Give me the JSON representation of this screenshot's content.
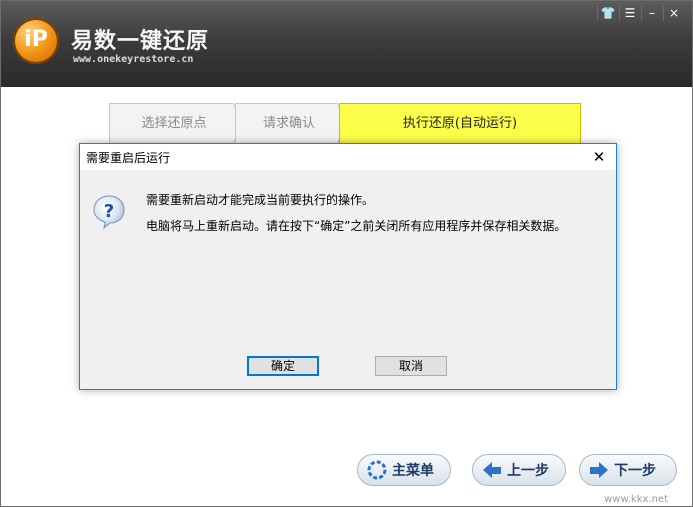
{
  "app": {
    "title": "易数一键还原",
    "url": "www.onekeyrestore.cn",
    "logo_text": "iP"
  },
  "window_controls": [
    "shirt-icon",
    "menu-icon",
    "minimize-icon",
    "close-icon"
  ],
  "window_control_glyphs": [
    "👕",
    "☰",
    "–",
    "×"
  ],
  "steps": [
    {
      "label": "选择还原点",
      "active": false
    },
    {
      "label": "请求确认",
      "active": false
    },
    {
      "label": "执行还原(自动运行)",
      "active": true
    }
  ],
  "bottom_buttons": {
    "menu_label": "主菜单",
    "prev_label": "上一步",
    "next_label": "下一步"
  },
  "watermark": "www.kkx.net",
  "dialog": {
    "title": "需要重启后运行",
    "close_glyph": "✕",
    "line1": "需要重新启动才能完成当前要执行的操作。",
    "line2": "电脑将马上重新启动。请在按下“确定”之前关闭所有应用程序并保存相关数据。",
    "ok_label": "确定",
    "cancel_label": "取消"
  },
  "colors": {
    "active_step": "#fcff4a",
    "header_dark": "#2a2a2a",
    "dialog_border": "#1883d7"
  }
}
